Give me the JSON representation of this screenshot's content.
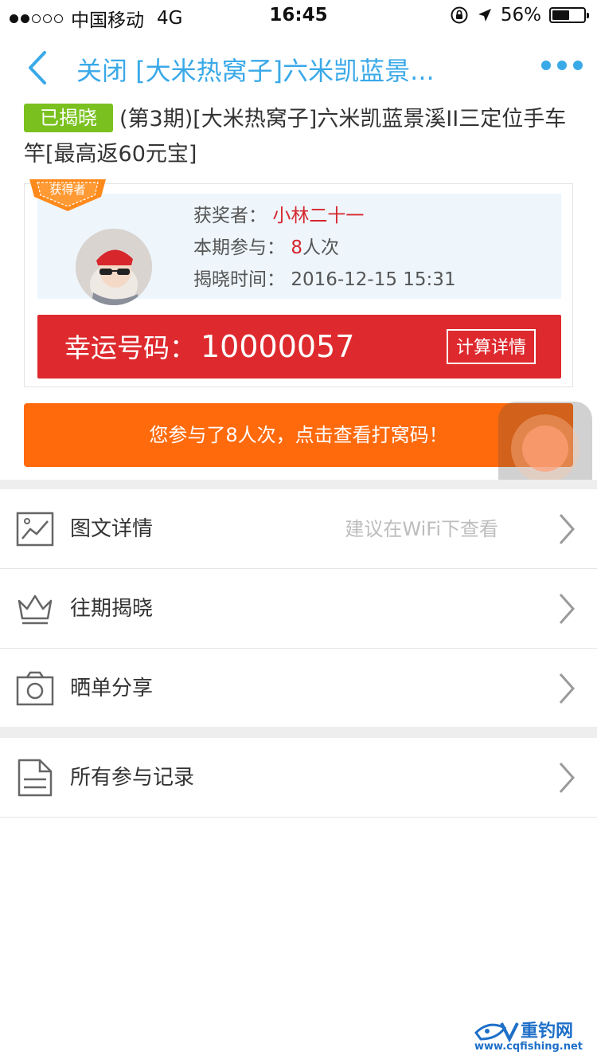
{
  "status_bar": {
    "carrier": "中国移动",
    "network": "4G",
    "time": "16:45",
    "battery": "56%",
    "battery_level": 0.56,
    "signal_bars_filled": 2,
    "signal_bars_total": 5
  },
  "nav": {
    "back_icon": "chevron-left",
    "title": "关闭 [大米热窝子]六米凯蓝景...",
    "more_icon": "ellipsis"
  },
  "product": {
    "status_badge": "已揭晓",
    "title": "(第3期)[大米热窝子]六米凯蓝景溪II三定位手车竿[最高返60元宝]"
  },
  "winner": {
    "ribbon_label": "获得者",
    "winner_label": "获奖者：",
    "winner_name": "小林二十一",
    "participation_label": "本期参与：",
    "participation_count": "8",
    "participation_unit": "人次",
    "reveal_time_label": "揭晓时间：",
    "reveal_time": "2016-12-15 15:31",
    "lucky_label": "幸运号码：",
    "lucky_number": "10000057",
    "calc_button": "计算详情"
  },
  "participation_button": "您参与了8人次，点击查看打窝码！",
  "menu": [
    {
      "icon": "image-icon",
      "label": "图文详情",
      "hint": "建议在WiFi下查看"
    },
    {
      "icon": "crown-icon",
      "label": "往期揭晓",
      "hint": ""
    },
    {
      "icon": "camera-icon",
      "label": "晒单分享",
      "hint": ""
    },
    {
      "icon": "document-icon",
      "label": "所有参与记录",
      "hint": ""
    }
  ],
  "watermark": {
    "name": "重钓网",
    "url": "www.cqfishing.net"
  },
  "colors": {
    "accent_blue": "#3aa9e8",
    "badge_green": "#7ac11f",
    "lucky_red": "#de2a2e",
    "button_orange": "#ff6a0d"
  }
}
